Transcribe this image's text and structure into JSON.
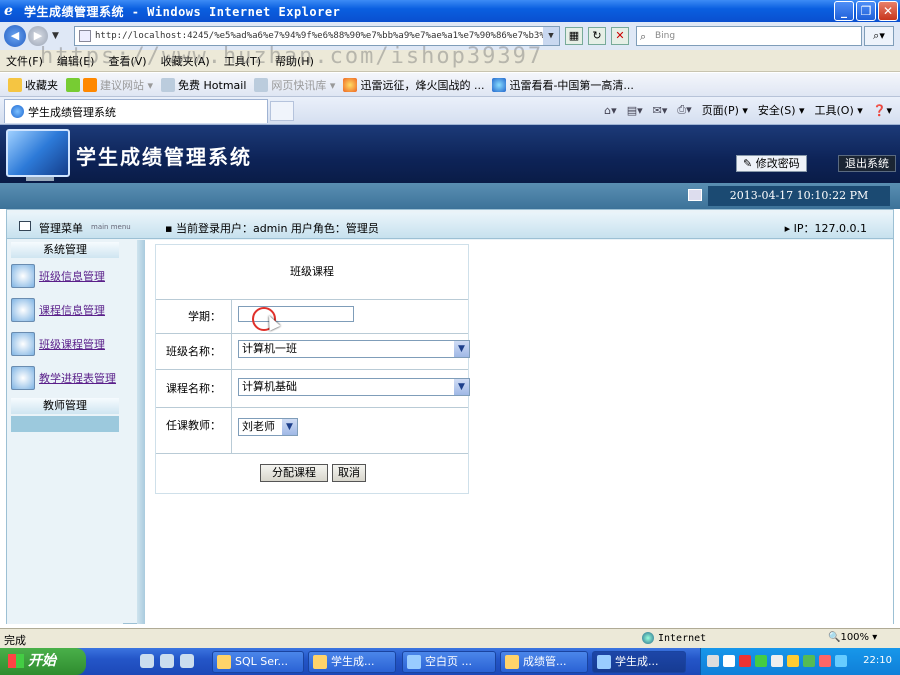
{
  "window": {
    "title": "学生成绩管理系统 - Windows Internet Explorer"
  },
  "addressbar": {
    "url": "http://localhost:4245/%e5%ad%a6%e7%94%9f%e6%88%90%e7%bb%a9%e7%ae%a1%e7%90%86%e7%b3%bb",
    "search_placeholder": "Bing"
  },
  "menu": [
    "文件(F)",
    "编辑(E)",
    "查看(V)",
    "收藏夹(A)",
    "工具(T)",
    "帮助(H)"
  ],
  "watermark": "https://www.huzhan.com/ishop39397",
  "favorites": {
    "label": "收藏夹",
    "items": [
      "建议网站 ▾",
      "免费 Hotmail",
      "网页快讯库 ▾",
      "迅雷远征，烽火国战的 ...",
      "迅雷看看-中国第一高清..."
    ]
  },
  "tab": {
    "label": "学生成绩管理系统"
  },
  "commandbar": [
    "页面(P) ▾",
    "安全(S) ▾",
    "工具(O) ▾",
    "❓▾"
  ],
  "app": {
    "title": "学生成绩管理系统",
    "change_password": "修改密码",
    "logout": "退出系统",
    "datetime": "2013-04-17 10:10:22 PM"
  },
  "subheader": {
    "menu_title": "管理菜单",
    "menu_en": "main menu",
    "current_user": "当前登录用户：admin  用户角色：管理员",
    "ip": "IP：127.0.0.1"
  },
  "leftnav": {
    "section1": "系统管理",
    "items": [
      "班级信息管理",
      "课程信息管理",
      "班级课程管理",
      "教学进程表管理"
    ],
    "section2": "教师管理"
  },
  "form": {
    "title": "班级课程",
    "term_label": "学期：",
    "term_value": "",
    "class_label": "班级名称：",
    "class_value": "计算机一班",
    "course_label": "课程名称：",
    "course_value": "计算机基础",
    "teacher_label": "任课教师：",
    "teacher_value": "刘老师",
    "assign_button": "分配课程",
    "cancel_button": "取消"
  },
  "statusbar": {
    "status": "完成",
    "zone": "Internet",
    "zoom": "🔍100%  ▾"
  },
  "taskbar": {
    "start": "开始",
    "tasks": [
      "SQL Ser...",
      "学生成...",
      "空白页 ...",
      "成绩管...",
      "学生成..."
    ],
    "clock": "22:10"
  },
  "colors": {
    "header_bg": "#0d2357",
    "nav_link": "#5a1f8a",
    "timestrip": "#3c7299",
    "taskbar": "#2456c8"
  }
}
